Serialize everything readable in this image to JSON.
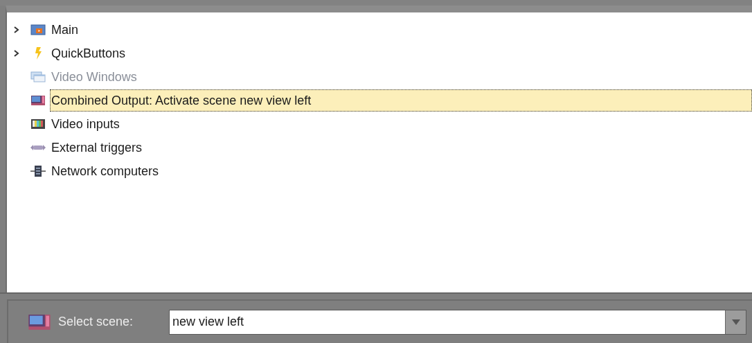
{
  "tree": {
    "items": [
      {
        "label": "Main",
        "kind": "group",
        "expanded": false,
        "selected": false,
        "disabled": false
      },
      {
        "label": "QuickButtons",
        "kind": "group",
        "expanded": false,
        "selected": false,
        "disabled": false
      },
      {
        "label": "Video Windows",
        "kind": "leaf",
        "selected": false,
        "disabled": true
      },
      {
        "label": "Combined Output: Activate scene new view left",
        "kind": "leaf",
        "selected": true,
        "disabled": false
      },
      {
        "label": "Video inputs",
        "kind": "leaf",
        "selected": false,
        "disabled": false
      },
      {
        "label": "External triggers",
        "kind": "leaf",
        "selected": false,
        "disabled": false
      },
      {
        "label": "Network computers",
        "kind": "leaf",
        "selected": false,
        "disabled": false
      }
    ]
  },
  "scene_bar": {
    "label": "Select scene:",
    "value": "new view left"
  }
}
